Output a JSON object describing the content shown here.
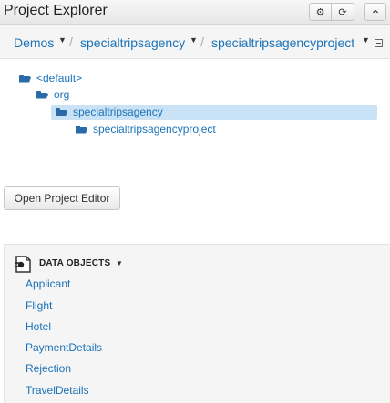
{
  "header": {
    "title": "Project Explorer",
    "buttons": [
      {
        "icon": "gear-icon",
        "glyph": "⚙"
      },
      {
        "icon": "refresh-icon",
        "glyph": "⟳"
      },
      {
        "icon": "chevron-up-icon",
        "glyph": "⌃"
      }
    ]
  },
  "breadcrumb": {
    "items": [
      "Demos",
      "specialtripsagency",
      "specialtripsagencyproject"
    ],
    "separator": "/",
    "caret": "▼"
  },
  "tree": {
    "items": [
      {
        "label": "<default>",
        "level": 0,
        "selected": false
      },
      {
        "label": "org",
        "level": 1,
        "selected": false
      },
      {
        "label": "specialtripsagency",
        "level": 2,
        "selected": true
      },
      {
        "label": "specialtripsagencyproject",
        "level": 3,
        "selected": false
      }
    ]
  },
  "actions": {
    "open_project_editor": "Open Project Editor"
  },
  "data_objects": {
    "title": "DATA OBJECTS",
    "caret": "▼",
    "items": [
      "Applicant",
      "Flight",
      "Hotel",
      "PaymentDetails",
      "Rejection",
      "TravelDetails"
    ]
  },
  "colors": {
    "link": "#1b72b8",
    "selection": "#c9e2f5",
    "folder": "#2a6aa8"
  }
}
